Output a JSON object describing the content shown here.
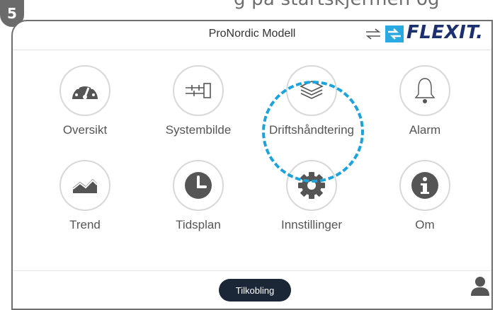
{
  "crop": {
    "partial_text": "g på startskjermen og"
  },
  "step": {
    "number": "5"
  },
  "header": {
    "title": "ProNordic Modell",
    "logo_text": "FLEXIT."
  },
  "tiles": [
    {
      "label": "Oversikt",
      "icon": "gauge-icon"
    },
    {
      "label": "Systembilde",
      "icon": "system-diagram-icon"
    },
    {
      "label": "Driftshåndtering",
      "icon": "layers-icon"
    },
    {
      "label": "Alarm",
      "icon": "bell-icon"
    },
    {
      "label": "Trend",
      "icon": "trend-chart-icon"
    },
    {
      "label": "Tidsplan",
      "icon": "clock-icon"
    },
    {
      "label": "Innstillinger",
      "icon": "gear-icon"
    },
    {
      "label": "Om",
      "icon": "info-icon"
    }
  ],
  "footer": {
    "connect_label": "Tilkobling"
  },
  "colors": {
    "accent": "#1aa3dd",
    "brand": "#1c2f6e",
    "icon": "#555555",
    "button": "#1b2637"
  }
}
